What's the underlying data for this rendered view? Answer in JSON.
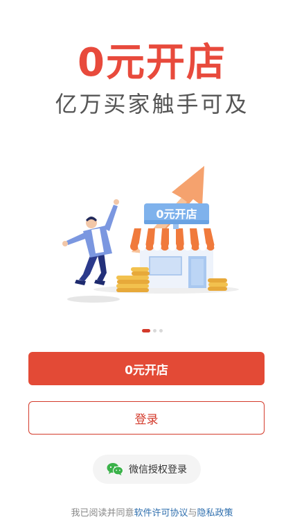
{
  "headline": {
    "zero": "0",
    "rest": "元开店"
  },
  "subtitle": "亿万买家触手可及",
  "illustration": {
    "shop_sign": "0元开店"
  },
  "carousel": {
    "total": 3,
    "active_index": 0
  },
  "buttons": {
    "open_shop": "0元开店",
    "login": "登录",
    "wechat_login": "微信授权登录"
  },
  "agreement": {
    "prefix": "我已阅读并同意",
    "software_license": "软件许可协议",
    "connector": "与",
    "privacy_policy": "隐私政策"
  },
  "colors": {
    "brand_red": "#e84a3c",
    "button_red": "#e34a36",
    "outline_red": "#d33a2b",
    "subtitle_gray": "#555555",
    "link_blue": "#2f6fae",
    "wechat_green": "#3bb24a"
  }
}
